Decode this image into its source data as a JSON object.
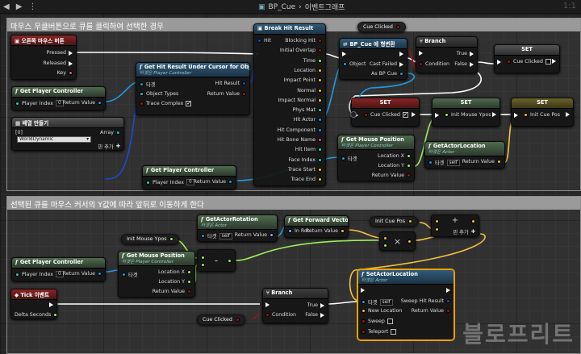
{
  "topbar": {
    "blueprint": "BP_Cue",
    "separator": "›",
    "graph": "이벤트그래프",
    "zoom": "1:1"
  },
  "comments": {
    "c1": "마우스 우클버튼으로 큐를 클릭하여 선택한 경우",
    "c2": "선택된 큐를 마우스 커서의 Y값에 따라 앞뒤로 이동하게 한다"
  },
  "nodes": {
    "rmb": {
      "title": "오른쪽 마우스 버튼",
      "p1": "Pressed",
      "p2": "Released",
      "p3": "Key"
    },
    "gpc1": {
      "title": "Get Player Controller",
      "in": "Player Index",
      "val": "0",
      "out": "Return Value"
    },
    "arr": {
      "title": "배열 만들기",
      "idx": "[0]",
      "sel": "WorldDynamic",
      "out": "Array",
      "add": "핀 추가"
    },
    "ghr": {
      "title": "Get Hit Result Under Cursor for Objects",
      "sub": "타겟은 Player Controller",
      "p1": "타겟",
      "p2": "Object Types",
      "p3": "Trace Complex",
      "o1": "Hit Result",
      "o2": "Return Value"
    },
    "gpc2": {
      "title": "Get Player Controller",
      "in": "Player Index",
      "val": "0",
      "out": "Return Value"
    },
    "bhr": {
      "title": "Break Hit Result",
      "in": "Hit",
      "outs": [
        "Blocking Hit",
        "Initial Overlap",
        "Time",
        "Location",
        "Impact Point",
        "Normal",
        "Impact Normal",
        "Phys Mat",
        "Hit Actor",
        "Hit Component",
        "Hit Bone Name",
        "Hit Item",
        "Face Index",
        "Trace Start",
        "Trace End"
      ]
    },
    "cast": {
      "title": "BP_Cue 에 형변환",
      "in": "Object",
      "o1": "Cast Failed",
      "o2": "As BP Cue"
    },
    "branch1": {
      "title": "Branch",
      "in": "Condition",
      "o1": "True",
      "o2": "False"
    },
    "set1": {
      "title": "SET",
      "in": "Cue Clicked"
    },
    "set2": {
      "title": "SET",
      "in": "Cue Clicked"
    },
    "set3": {
      "title": "SET",
      "in": "Init Mouse Ypos"
    },
    "set4": {
      "title": "SET",
      "in": "Init Cue Pos"
    },
    "gmp1": {
      "title": "Get Mouse Position",
      "sub": "타겟은 Player Controller",
      "in": "타겟",
      "o1": "Location X",
      "o2": "Location Y",
      "o3": "Return Value"
    },
    "gal1": {
      "title": "GetActorLocation",
      "sub": "타겟은 Actor",
      "in": "타겟",
      "self": "self",
      "out": "Return Value"
    },
    "gar": {
      "title": "GetActorRotation",
      "sub": "타겟은 Actor",
      "in": "타겟",
      "self": "self",
      "out": "Return Value"
    },
    "gfv": {
      "title": "Get Forward Vector",
      "in": "In Rot",
      "out": "Return Value"
    },
    "gpc3": {
      "title": "Get Player Controller",
      "in": "Player Index",
      "val": "0",
      "out": "Return Value"
    },
    "gmp2": {
      "title": "Get Mouse Position",
      "sub": "타겟은 Player Controller",
      "in": "타겟",
      "o1": "Location X",
      "o2": "Location Y",
      "o3": "Return Value"
    },
    "minus": {
      "title": "-"
    },
    "mult": {
      "title": "×"
    },
    "plus": {
      "title": "+",
      "add": "핀 추가"
    },
    "tick": {
      "title": "Tick 이벤트",
      "out": "Delta Seconds"
    },
    "branch2": {
      "title": "Branch",
      "in": "Condition",
      "o1": "True",
      "o2": "False"
    },
    "sal": {
      "title": "SetActorLocation",
      "sub": "타겟은 Actor",
      "p1": "타겟",
      "self": "self",
      "p2": "New Location",
      "p3": "Sweep",
      "p4": "Teleport",
      "o1": "Sweep Hit Result",
      "o2": "Return Value"
    }
  },
  "vars": {
    "v1": "Cue Clicked",
    "v2": "Init Mouse Ypos",
    "v3": "Init Cue Pos",
    "v4": "Cue Clicked"
  },
  "watermark": "블로프리트",
  "colors": {
    "exec": "#ffffff",
    "object": "#1e9be0",
    "vector": "#f0c040",
    "float": "#9cf05a",
    "bool": "#9a1616",
    "struct": "#1a4ad0",
    "array": "#19a0a0"
  }
}
